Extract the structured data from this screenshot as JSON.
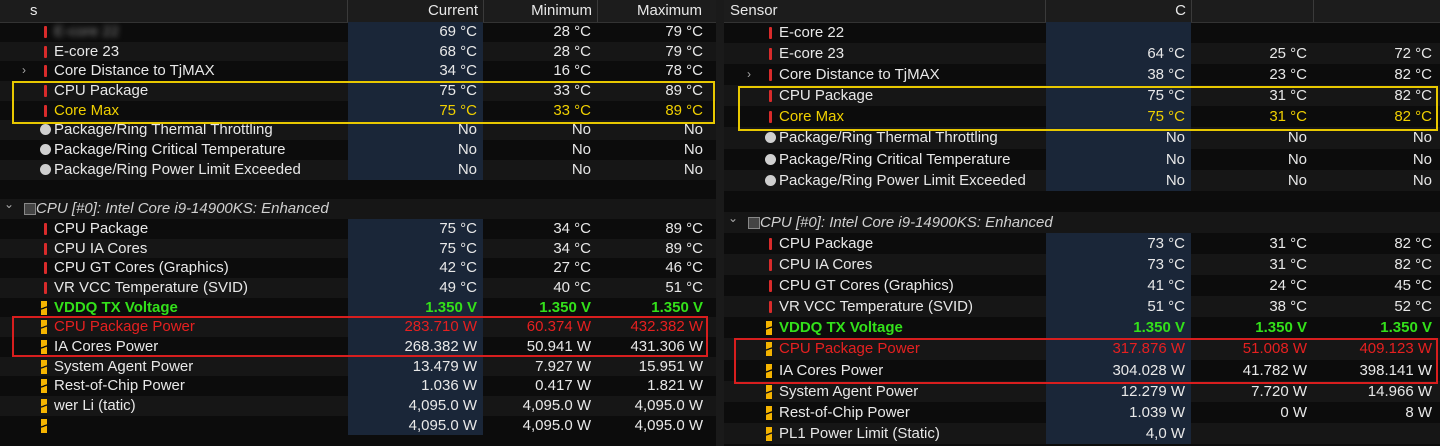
{
  "left": {
    "header": {
      "sensor": "s",
      "current": "Current",
      "minimum": "Minimum",
      "maximum": "Maximum"
    },
    "rows": [
      {
        "icon": "temp",
        "label": "E-core 22",
        "cur": "69 °C",
        "min": "28 °C",
        "max": "79 °C",
        "style": "",
        "blurLabel": true
      },
      {
        "icon": "temp",
        "label": "E-core 23",
        "cur": "68 °C",
        "min": "28 °C",
        "max": "79 °C",
        "style": ""
      },
      {
        "icon": "temp",
        "expand": true,
        "label": "Core Distance to TjMAX",
        "cur": "34 °C",
        "min": "16 °C",
        "max": "78 °C",
        "style": ""
      },
      {
        "icon": "temp",
        "label": "CPU Package",
        "cur": "75 °C",
        "min": "33 °C",
        "max": "89 °C",
        "style": ""
      },
      {
        "icon": "temp",
        "label": "Core Max",
        "cur": "75 °C",
        "min": "33 °C",
        "max": "89 °C",
        "style": "yellow"
      },
      {
        "icon": "circ",
        "label": "Package/Ring Thermal Throttling",
        "cur": "No",
        "min": "No",
        "max": "No",
        "style": ""
      },
      {
        "icon": "circ",
        "label": "Package/Ring Critical Temperature",
        "cur": "No",
        "min": "No",
        "max": "No",
        "style": ""
      },
      {
        "icon": "circ",
        "label": "Package/Ring Power Limit Exceeded",
        "cur": "No",
        "min": "No",
        "max": "No",
        "style": ""
      },
      {
        "icon": "none",
        "label": "",
        "cur": "",
        "min": "",
        "max": "",
        "style": ""
      },
      {
        "icon": "chip",
        "group": true,
        "label": "CPU [#0]: Intel Core i9-14900KS: Enhanced",
        "cur": "",
        "min": "",
        "max": "",
        "style": "ital"
      },
      {
        "icon": "temp",
        "label": "CPU Package",
        "cur": "75 °C",
        "min": "34 °C",
        "max": "89 °C",
        "style": ""
      },
      {
        "icon": "temp",
        "label": "CPU IA Cores",
        "cur": "75 °C",
        "min": "34 °C",
        "max": "89 °C",
        "style": ""
      },
      {
        "icon": "temp",
        "label": "CPU GT Cores (Graphics)",
        "cur": "42 °C",
        "min": "27 °C",
        "max": "46 °C",
        "style": ""
      },
      {
        "icon": "temp",
        "label": "VR VCC Temperature (SVID)",
        "cur": "49 °C",
        "min": "40 °C",
        "max": "51 °C",
        "style": ""
      },
      {
        "icon": "volt",
        "label": "VDDQ TX Voltage",
        "cur": "1.350 V",
        "min": "1.350 V",
        "max": "1.350 V",
        "style": "green"
      },
      {
        "icon": "volt",
        "label": "CPU Package Power",
        "cur": "283.710 W",
        "min": "60.374 W",
        "max": "432.382 W",
        "style": "red"
      },
      {
        "icon": "volt",
        "label": "IA Cores Power",
        "cur": "268.382 W",
        "min": "50.941 W",
        "max": "431.306 W",
        "style": ""
      },
      {
        "icon": "volt",
        "label": "System Agent Power",
        "cur": "13.479 W",
        "min": "7.927 W",
        "max": "15.951 W",
        "style": ""
      },
      {
        "icon": "volt",
        "label": "Rest-of-Chip Power",
        "cur": "1.036 W",
        "min": "0.417 W",
        "max": "1.821 W",
        "style": ""
      },
      {
        "icon": "volt",
        "label": "wer Li (tatic)",
        "cur": "4,095.0 W",
        "min": "4,095.0 W",
        "max": "4,095.0 W",
        "style": ""
      },
      {
        "icon": "volt",
        "label": "",
        "cur": "4,095.0 W",
        "min": "4,095.0 W",
        "max": "4,095.0 W",
        "style": ""
      }
    ]
  },
  "right": {
    "header": {
      "sensor": "Sensor",
      "current": "C",
      "minimum": "",
      "maximum": ""
    },
    "rows": [
      {
        "icon": "temp",
        "label": "E-core 22",
        "cur": "",
        "min": "",
        "max": "",
        "style": ""
      },
      {
        "icon": "temp",
        "label": "E-core 23",
        "cur": "64 °C",
        "min": "25 °C",
        "max": "72 °C",
        "style": ""
      },
      {
        "icon": "temp",
        "expand": true,
        "label": "Core Distance to TjMAX",
        "cur": "38 °C",
        "min": "23 °C",
        "max": "82 °C",
        "style": ""
      },
      {
        "icon": "temp",
        "label": "CPU Package",
        "cur": "75 °C",
        "min": "31 °C",
        "max": "82 °C",
        "style": ""
      },
      {
        "icon": "temp",
        "label": "Core Max",
        "cur": "75 °C",
        "min": "31 °C",
        "max": "82 °C",
        "style": "yellow"
      },
      {
        "icon": "circ",
        "label": "Package/Ring Thermal Throttling",
        "cur": "No",
        "min": "No",
        "max": "No",
        "style": ""
      },
      {
        "icon": "circ",
        "label": "Package/Ring Critical Temperature",
        "cur": "No",
        "min": "No",
        "max": "No",
        "style": ""
      },
      {
        "icon": "circ",
        "label": "Package/Ring Power Limit Exceeded",
        "cur": "No",
        "min": "No",
        "max": "No",
        "style": ""
      },
      {
        "icon": "none",
        "label": "",
        "cur": "",
        "min": "",
        "max": "",
        "style": ""
      },
      {
        "icon": "chip",
        "group": true,
        "label": "CPU [#0]: Intel Core i9-14900KS: Enhanced",
        "cur": "",
        "min": "",
        "max": "",
        "style": "ital"
      },
      {
        "icon": "temp",
        "label": "CPU Package",
        "cur": "73 °C",
        "min": "31 °C",
        "max": "82 °C",
        "style": ""
      },
      {
        "icon": "temp",
        "label": "CPU IA Cores",
        "cur": "73 °C",
        "min": "31 °C",
        "max": "82 °C",
        "style": ""
      },
      {
        "icon": "temp",
        "label": "CPU GT Cores (Graphics)",
        "cur": "41 °C",
        "min": "24 °C",
        "max": "45 °C",
        "style": ""
      },
      {
        "icon": "temp",
        "label": "VR VCC Temperature (SVID)",
        "cur": "51 °C",
        "min": "38 °C",
        "max": "52 °C",
        "style": ""
      },
      {
        "icon": "volt",
        "label": "VDDQ TX Voltage",
        "cur": "1.350 V",
        "min": "1.350 V",
        "max": "1.350 V",
        "style": "green"
      },
      {
        "icon": "volt",
        "label": "CPU Package Power",
        "cur": "317.876 W",
        "min": "51.008 W",
        "max": "409.123 W",
        "style": "red"
      },
      {
        "icon": "volt",
        "label": "IA Cores Power",
        "cur": "304.028 W",
        "min": "41.782 W",
        "max": "398.141 W",
        "style": ""
      },
      {
        "icon": "volt",
        "label": "System Agent Power",
        "cur": "12.279 W",
        "min": "7.720 W",
        "max": "14.966 W",
        "style": ""
      },
      {
        "icon": "volt",
        "label": "Rest-of-Chip Power",
        "cur": "1.039 W",
        "min": "0 W",
        "max": "8 W",
        "style": ""
      },
      {
        "icon": "volt",
        "label": "PL1 Power Limit (Static)",
        "cur": "4,0 W",
        "min": "",
        "max": "",
        "style": ""
      }
    ]
  },
  "colors": {
    "highlight_yellow": "#e8c800",
    "highlight_red": "#d81e1e",
    "voltage_green": "#33e01a",
    "power_red": "#e52020"
  }
}
